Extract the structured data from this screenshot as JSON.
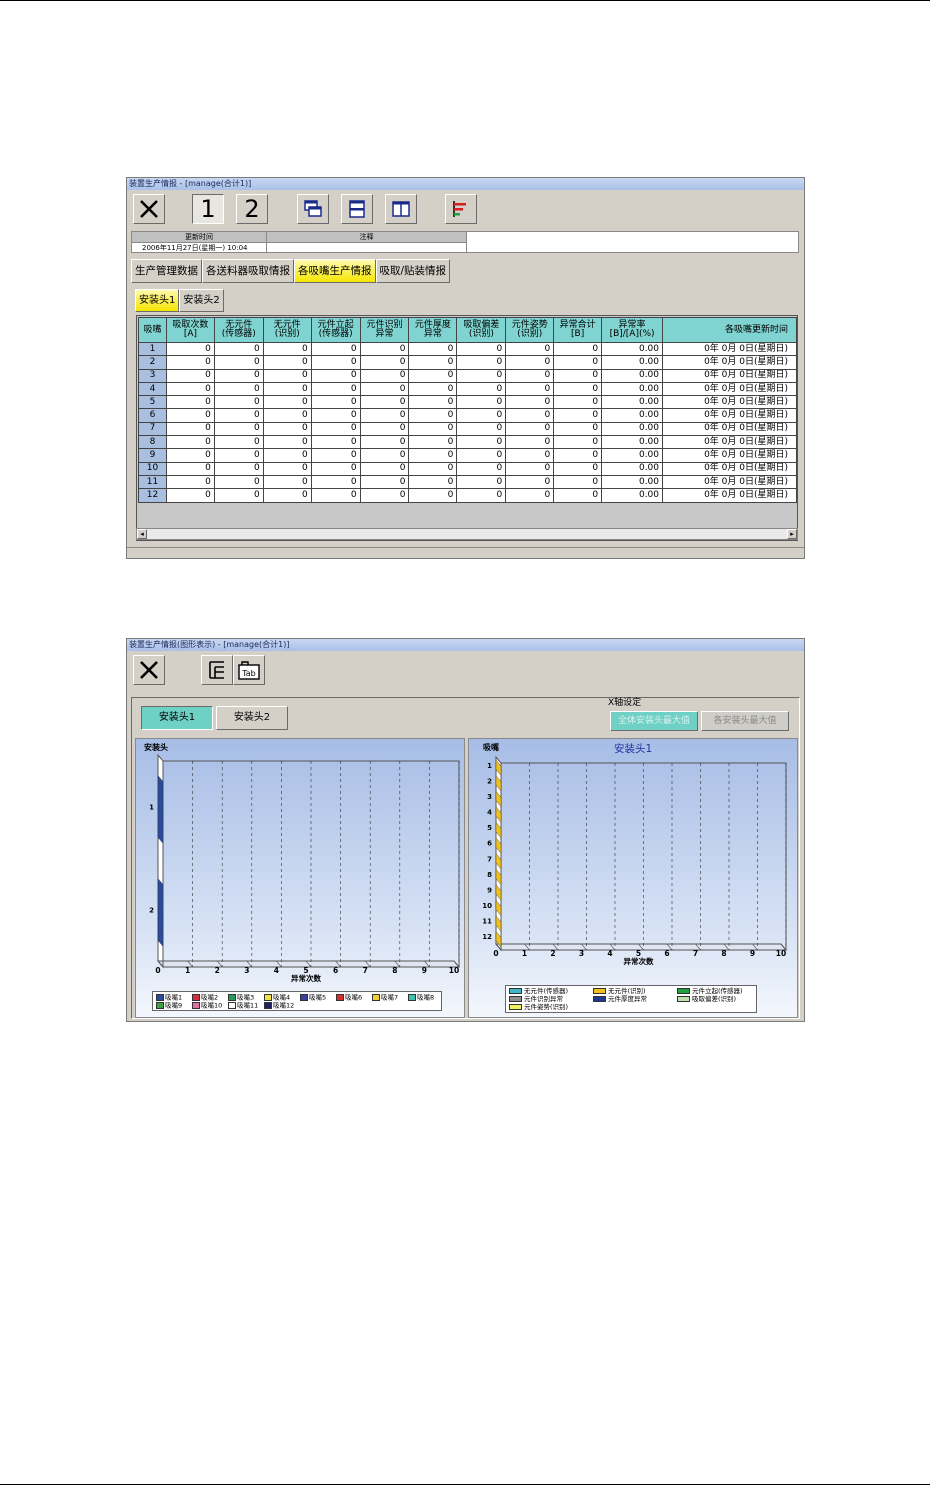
{
  "window1": {
    "title": "装置生产情报 - [manage(合计1)]",
    "toolbar": {
      "head1": "1",
      "head2": "2"
    },
    "update": {
      "time_header": "更新时间",
      "note_header": "注释",
      "time_value": "2006年11月27日(星期一) 10:04",
      "note_value": ""
    },
    "tabs": [
      "生产管理数据",
      "各送料器吸取情报",
      "各吸嘴生产情报",
      "吸取/贴装情报"
    ],
    "active_tab": 2,
    "subtabs": [
      "安装头1",
      "安装头2"
    ],
    "active_subtab": 0,
    "table": {
      "columns": [
        "吸嘴",
        "吸取次数\n[A]",
        "无元件\n(传感器)",
        "无元件\n(识别)",
        "元件立起\n(传感器)",
        "元件识别\n异常",
        "元件厚度\n异常",
        "吸取偏差\n(识别)",
        "元件姿势\n(识别)",
        "异常合计\n[B]",
        "异常率\n[B]/[A](%)",
        "各吸嘴更新时间"
      ],
      "rows": [
        [
          "1",
          "0",
          "0",
          "0",
          "0",
          "0",
          "0",
          "0",
          "0",
          "0",
          "0.00",
          "0年 0月 0日(星期日)"
        ],
        [
          "2",
          "0",
          "0",
          "0",
          "0",
          "0",
          "0",
          "0",
          "0",
          "0",
          "0.00",
          "0年 0月 0日(星期日)"
        ],
        [
          "3",
          "0",
          "0",
          "0",
          "0",
          "0",
          "0",
          "0",
          "0",
          "0",
          "0.00",
          "0年 0月 0日(星期日)"
        ],
        [
          "4",
          "0",
          "0",
          "0",
          "0",
          "0",
          "0",
          "0",
          "0",
          "0",
          "0.00",
          "0年 0月 0日(星期日)"
        ],
        [
          "5",
          "0",
          "0",
          "0",
          "0",
          "0",
          "0",
          "0",
          "0",
          "0",
          "0.00",
          "0年 0月 0日(星期日)"
        ],
        [
          "6",
          "0",
          "0",
          "0",
          "0",
          "0",
          "0",
          "0",
          "0",
          "0",
          "0.00",
          "0年 0月 0日(星期日)"
        ],
        [
          "7",
          "0",
          "0",
          "0",
          "0",
          "0",
          "0",
          "0",
          "0",
          "0",
          "0.00",
          "0年 0月 0日(星期日)"
        ],
        [
          "8",
          "0",
          "0",
          "0",
          "0",
          "0",
          "0",
          "0",
          "0",
          "0",
          "0.00",
          "0年 0月 0日(星期日)"
        ],
        [
          "9",
          "0",
          "0",
          "0",
          "0",
          "0",
          "0",
          "0",
          "0",
          "0",
          "0.00",
          "0年 0月 0日(星期日)"
        ],
        [
          "10",
          "0",
          "0",
          "0",
          "0",
          "0",
          "0",
          "0",
          "0",
          "0",
          "0.00",
          "0年 0月 0日(星期日)"
        ],
        [
          "11",
          "0",
          "0",
          "0",
          "0",
          "0",
          "0",
          "0",
          "0",
          "0",
          "0.00",
          "0年 0月 0日(星期日)"
        ],
        [
          "12",
          "0",
          "0",
          "0",
          "0",
          "0",
          "0",
          "0",
          "0",
          "0",
          "0.00",
          "0年 0月 0日(星期日)"
        ]
      ]
    }
  },
  "window2": {
    "title": "装置生产情报(图形表示) - [manage(合计1)]",
    "head_buttons": [
      "安装头1",
      "安装头2"
    ],
    "active_head": 0,
    "xaxis_group": {
      "label": "X轴设定",
      "options": [
        "全体安装头最大值",
        "各安装头最大值"
      ],
      "active": 0
    }
  },
  "chart_data": [
    {
      "type": "bar",
      "orientation": "horizontal",
      "title": "安装头",
      "xlabel": "异常次数",
      "ylabel": "",
      "categories": [
        "1",
        "2"
      ],
      "xlim": [
        0,
        10
      ],
      "xticks": [
        "0",
        "1",
        "2",
        "3",
        "4",
        "5",
        "6",
        "7",
        "8",
        "9",
        "10"
      ],
      "stacked": true,
      "series": [
        {
          "name": "吸嘴1",
          "color": "#2a4a9a",
          "values": [
            0,
            0
          ]
        },
        {
          "name": "吸嘴2",
          "color": "#d03040",
          "values": [
            0,
            0
          ]
        },
        {
          "name": "吸嘴3",
          "color": "#2a9a5a",
          "values": [
            0,
            0
          ]
        },
        {
          "name": "吸嘴4",
          "color": "#f0e040",
          "values": [
            0,
            0
          ]
        },
        {
          "name": "吸嘴5",
          "color": "#3a40a0",
          "values": [
            0,
            0
          ]
        },
        {
          "name": "吸嘴6",
          "color": "#d03030",
          "values": [
            0,
            0
          ]
        },
        {
          "name": "吸嘴7",
          "color": "#f0d030",
          "values": [
            0,
            0
          ]
        },
        {
          "name": "吸嘴8",
          "color": "#40c0b0",
          "values": [
            0,
            0
          ]
        },
        {
          "name": "吸嘴9",
          "color": "#40a040",
          "values": [
            0,
            0
          ]
        },
        {
          "name": "吸嘴10",
          "color": "#e070a0",
          "values": [
            0,
            0
          ]
        },
        {
          "name": "吸嘴11",
          "color": "#ffffff",
          "values": [
            0,
            0
          ]
        },
        {
          "name": "吸嘴12",
          "color": "#202060",
          "values": [
            0,
            0
          ]
        }
      ],
      "grid": true,
      "legend": "bottom"
    },
    {
      "type": "bar",
      "orientation": "horizontal",
      "title": "安装头1",
      "ytitle": "吸嘴",
      "xlabel": "异常次数",
      "categories": [
        "1",
        "2",
        "3",
        "4",
        "5",
        "6",
        "7",
        "8",
        "9",
        "10",
        "11",
        "12"
      ],
      "xlim": [
        0,
        10
      ],
      "xticks": [
        "0",
        "1",
        "2",
        "3",
        "4",
        "5",
        "6",
        "7",
        "8",
        "9",
        "10"
      ],
      "stacked": true,
      "series": [
        {
          "name": "无元件(传感器)",
          "color": "#40b8c8",
          "values": [
            0,
            0,
            0,
            0,
            0,
            0,
            0,
            0,
            0,
            0,
            0,
            0
          ]
        },
        {
          "name": "无元件(识别)",
          "color": "#f0c020",
          "values": [
            0,
            0,
            0,
            0,
            0,
            0,
            0,
            0,
            0,
            0,
            0,
            0
          ]
        },
        {
          "name": "元件立起(传感器)",
          "color": "#20a040",
          "values": [
            0,
            0,
            0,
            0,
            0,
            0,
            0,
            0,
            0,
            0,
            0,
            0
          ]
        },
        {
          "name": "元件识别异常",
          "color": "#909090",
          "values": [
            0,
            0,
            0,
            0,
            0,
            0,
            0,
            0,
            0,
            0,
            0,
            0
          ]
        },
        {
          "name": "元件厚度异常",
          "color": "#203890",
          "values": [
            0,
            0,
            0,
            0,
            0,
            0,
            0,
            0,
            0,
            0,
            0,
            0
          ]
        },
        {
          "name": "吸取偏差(识别)",
          "color": "#c0e0b0",
          "values": [
            0,
            0,
            0,
            0,
            0,
            0,
            0,
            0,
            0,
            0,
            0,
            0
          ]
        },
        {
          "name": "元件姿势(识别)",
          "color": "#f0f060",
          "values": [
            0,
            0,
            0,
            0,
            0,
            0,
            0,
            0,
            0,
            0,
            0,
            0
          ]
        }
      ],
      "grid": true,
      "legend": "bottom"
    }
  ]
}
